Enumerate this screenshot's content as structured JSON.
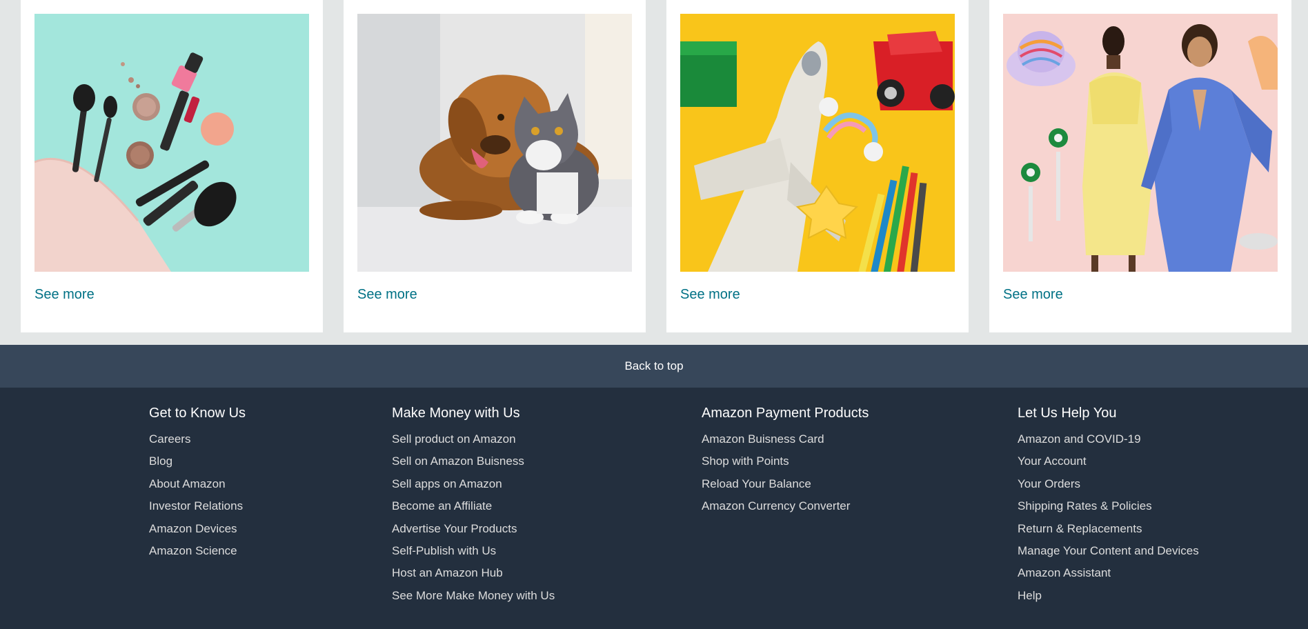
{
  "cards": [
    {
      "see_more": "See more"
    },
    {
      "see_more": "See more"
    },
    {
      "see_more": "See more"
    },
    {
      "see_more": "See more"
    }
  ],
  "back_to_top": "Back to top",
  "footer": {
    "columns": [
      {
        "heading": "Get to Know Us",
        "links": [
          "Careers",
          "Blog",
          "About Amazon",
          "Investor Relations",
          "Amazon Devices",
          "Amazon Science"
        ]
      },
      {
        "heading": "Make Money with Us",
        "links": [
          "Sell product on Amazon",
          "Sell on Amazon Buisness",
          "Sell apps on Amazon",
          "Become an Affiliate",
          "Advertise Your Products",
          "Self-Publish with Us",
          "Host an Amazon Hub",
          "See More Make Money with Us"
        ]
      },
      {
        "heading": "Amazon Payment Products",
        "links": [
          "Amazon Buisness Card",
          "Shop with Points",
          "Reload Your Balance",
          "Amazon Currency Converter"
        ]
      },
      {
        "heading": "Let Us Help You",
        "links": [
          "Amazon and COVID-19",
          "Your Account",
          "Your Orders",
          "Shipping Rates & Policies",
          "Return & Replacements",
          "Manage Your Content and Devices",
          "Amazon Assistant",
          "Help"
        ]
      }
    ]
  },
  "colors": {
    "page_bg": "#e3e6e6",
    "link": "#007185",
    "back_to_top_bg": "#37475a",
    "footer_bg": "#232f3e"
  }
}
